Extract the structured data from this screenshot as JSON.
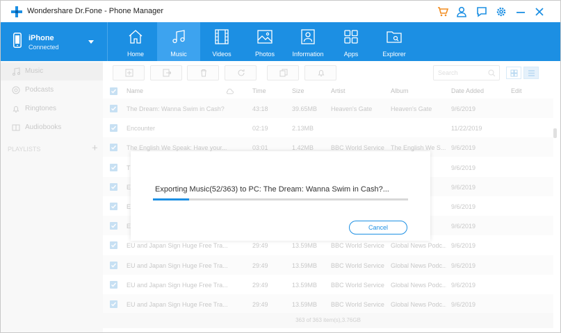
{
  "window": {
    "title": "Wondershare Dr.Fone - Phone Manager",
    "icons": [
      "cart-icon",
      "user-icon",
      "feedback-icon",
      "settings-icon",
      "minimize-icon",
      "close-icon"
    ],
    "accent_color": "#1c8fe3",
    "cart_color": "#f28c1e"
  },
  "device": {
    "name": "iPhone",
    "status": "Connected"
  },
  "nav": {
    "items": [
      {
        "label": "Home",
        "icon": "home-icon"
      },
      {
        "label": "Music",
        "icon": "music-icon",
        "active": true
      },
      {
        "label": "Videos",
        "icon": "video-icon"
      },
      {
        "label": "Photos",
        "icon": "photo-icon"
      },
      {
        "label": "Information",
        "icon": "information-icon"
      },
      {
        "label": "Apps",
        "icon": "apps-icon"
      },
      {
        "label": "Explorer",
        "icon": "explorer-icon"
      }
    ]
  },
  "sidebar": {
    "items": [
      {
        "label": "Music",
        "icon": "music-note-icon",
        "active": true
      },
      {
        "label": "Podcasts",
        "icon": "podcast-icon"
      },
      {
        "label": "Ringtones",
        "icon": "bell-icon"
      },
      {
        "label": "Audiobooks",
        "icon": "book-icon"
      }
    ],
    "playlists_label": "PLAYLISTS",
    "add_label": "+"
  },
  "toolbar": {
    "buttons": [
      "add-icon",
      "export-icon",
      "delete-icon",
      "refresh-icon",
      "deduplicate-icon",
      "ringtone-maker-icon"
    ],
    "search_placeholder": "Search"
  },
  "table": {
    "columns": [
      "Name",
      "Time",
      "Size",
      "Artist",
      "Album",
      "Date Added",
      "Edit"
    ],
    "rows": [
      {
        "name": "The Dream: Wanna Swim in Cash?",
        "time": "43:18",
        "size": "39.65MB",
        "artist": "Heaven's Gate",
        "album": "Heaven's Gate",
        "date": "9/6/2019"
      },
      {
        "name": "Encounter",
        "time": "02:19",
        "size": "2.13MB",
        "artist": "",
        "album": "",
        "date": "11/22/2019"
      },
      {
        "name": "The English We Speak: Have your...",
        "time": "03:01",
        "size": "1.42MB",
        "artist": "BBC World Service",
        "album": "The English We S...",
        "date": "9/6/2019"
      },
      {
        "name": "T",
        "time": "",
        "size": "",
        "artist": "",
        "album": "e",
        "date": "9/6/2019"
      },
      {
        "name": "E",
        "time": "",
        "size": "",
        "artist": "",
        "album": "e",
        "date": "9/6/2019"
      },
      {
        "name": "E",
        "time": "",
        "size": "",
        "artist": "",
        "album": "e",
        "date": "9/6/2019"
      },
      {
        "name": "E",
        "time": "",
        "size": "",
        "artist": "",
        "album": "odc...",
        "date": "9/6/2019"
      },
      {
        "name": "EU and Japan Sign Huge Free Tra...",
        "time": "29:49",
        "size": "13.59MB",
        "artist": "BBC World Service",
        "album": "Global News Podc...",
        "date": "9/6/2019"
      },
      {
        "name": "EU and Japan Sign Huge Free Tra...",
        "time": "29:49",
        "size": "13.59MB",
        "artist": "BBC World Service",
        "album": "Global News Podc...",
        "date": "9/6/2019"
      },
      {
        "name": "EU and Japan Sign Huge Free Tra...",
        "time": "29:49",
        "size": "13.59MB",
        "artist": "BBC World Service",
        "album": "Global News Podc...",
        "date": "9/6/2019"
      },
      {
        "name": "EU and Japan Sign Huge Free Tra...",
        "time": "29:49",
        "size": "13.59MB",
        "artist": "BBC World Service",
        "album": "Global News Podc...",
        "date": "9/6/2019"
      }
    ],
    "footer": "363 of 363 item(s),3.76GB"
  },
  "dialog": {
    "message": "Exporting Music(52/363) to PC: The Dream: Wanna Swim in Cash?...",
    "progress_fraction": 0.143,
    "cancel_label": "Cancel"
  }
}
